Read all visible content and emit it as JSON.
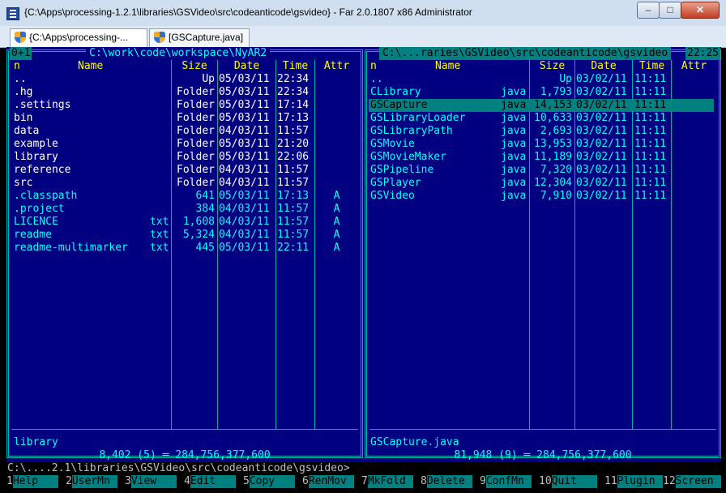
{
  "window": {
    "title": "{C:\\Apps\\processing-1.2.1\\libraries\\GSVideo\\src\\codeanticode\\gsvideo} - Far 2.0.1807 x86 Administrator",
    "minimize_label": "–",
    "maximize_label": "□",
    "close_label": "✕"
  },
  "tabs": [
    {
      "label": "{C:\\Apps\\processing-..."
    },
    {
      "label": "[GSCapture.java]"
    }
  ],
  "toolbar": {
    "console_number": "1"
  },
  "left_panel": {
    "marker": "0+1",
    "path": "C:\\work\\code\\workspace\\NyAR2",
    "headers": {
      "n": "n",
      "name": "Name",
      "size": "Size",
      "date": "Date",
      "time": "Time",
      "attr": "Attr"
    },
    "rows": [
      {
        "name": "..",
        "ext": "",
        "size": "Up",
        "date": "05/03/11",
        "time": "22:34",
        "attr": ""
      },
      {
        "name": ".hg",
        "ext": "",
        "size": "Folder",
        "date": "05/03/11",
        "time": "22:34",
        "attr": ""
      },
      {
        "name": ".settings",
        "ext": "",
        "size": "Folder",
        "date": "05/03/11",
        "time": "17:14",
        "attr": ""
      },
      {
        "name": "bin",
        "ext": "",
        "size": "Folder",
        "date": "05/03/11",
        "time": "17:13",
        "attr": ""
      },
      {
        "name": "data",
        "ext": "",
        "size": "Folder",
        "date": "04/03/11",
        "time": "11:57",
        "attr": ""
      },
      {
        "name": "example",
        "ext": "",
        "size": "Folder",
        "date": "05/03/11",
        "time": "21:20",
        "attr": ""
      },
      {
        "name": "library",
        "ext": "",
        "size": "Folder",
        "date": "05/03/11",
        "time": "22:06",
        "attr": ""
      },
      {
        "name": "reference",
        "ext": "",
        "size": "Folder",
        "date": "04/03/11",
        "time": "11:57",
        "attr": ""
      },
      {
        "name": "src",
        "ext": "",
        "size": "Folder",
        "date": "04/03/11",
        "time": "11:57",
        "attr": ""
      },
      {
        "name": ".classpath",
        "ext": "",
        "size": "641",
        "date": "05/03/11",
        "time": "17:13",
        "attr": "A"
      },
      {
        "name": ".project",
        "ext": "",
        "size": "384",
        "date": "04/03/11",
        "time": "11:57",
        "attr": "A"
      },
      {
        "name": "LICENCE",
        "ext": "txt",
        "size": "1,608",
        "date": "04/03/11",
        "time": "11:57",
        "attr": "A"
      },
      {
        "name": "readme",
        "ext": "txt",
        "size": "5,324",
        "date": "04/03/11",
        "time": "11:57",
        "attr": "A"
      },
      {
        "name": "readme-multimarker",
        "ext": "txt",
        "size": "445",
        "date": "05/03/11",
        "time": "22:11",
        "attr": "A"
      }
    ],
    "current_file": "library",
    "summary": "8,402 (5) ═ 284,756,377,600"
  },
  "right_panel": {
    "path": "C:\\...raries\\GSVideo\\src\\codeanticode\\gsvideo",
    "headers": {
      "n": "n",
      "name": "Name",
      "size": "Size",
      "date": "Date",
      "time": "Time",
      "attr": "Attr"
    },
    "rows": [
      {
        "name": "..",
        "ext": "",
        "size": "Up",
        "date": "03/02/11",
        "time": "11:11"
      },
      {
        "name": "CLibrary",
        "ext": "java",
        "size": "1,793",
        "date": "03/02/11",
        "time": "11:11"
      },
      {
        "name": "GSCapture",
        "ext": "java",
        "size": "14,153",
        "date": "03/02/11",
        "time": "11:11"
      },
      {
        "name": "GSLibraryLoader",
        "ext": "java",
        "size": "10,633",
        "date": "03/02/11",
        "time": "11:11"
      },
      {
        "name": "GSLibraryPath",
        "ext": "java",
        "size": "2,693",
        "date": "03/02/11",
        "time": "11:11"
      },
      {
        "name": "GSMovie",
        "ext": "java",
        "size": "13,953",
        "date": "03/02/11",
        "time": "11:11"
      },
      {
        "name": "GSMovieMaker",
        "ext": "java",
        "size": "11,189",
        "date": "03/02/11",
        "time": "11:11"
      },
      {
        "name": "GSPipeline",
        "ext": "java",
        "size": "7,320",
        "date": "03/02/11",
        "time": "11:11"
      },
      {
        "name": "GSPlayer",
        "ext": "java",
        "size": "12,304",
        "date": "03/02/11",
        "time": "11:11"
      },
      {
        "name": "GSVideo",
        "ext": "java",
        "size": "7,910",
        "date": "03/02/11",
        "time": "11:11"
      }
    ],
    "current_file": "GSCapture.java",
    "summary": "81,948 (9) ═ 284,756,377,600"
  },
  "clock": "22:25",
  "command_line": "C:\\....2.1\\libraries\\GSVideo\\src\\codeanticode\\gsvideo>",
  "keybar": [
    {
      "num": "1",
      "label": "Help"
    },
    {
      "num": "2",
      "label": "UserMn"
    },
    {
      "num": "3",
      "label": "View"
    },
    {
      "num": "4",
      "label": "Edit"
    },
    {
      "num": "5",
      "label": "Copy"
    },
    {
      "num": "6",
      "label": "RenMov"
    },
    {
      "num": "7",
      "label": "MkFold"
    },
    {
      "num": "8",
      "label": "Delete"
    },
    {
      "num": "9",
      "label": "ConfMn"
    },
    {
      "num": "10",
      "label": "Quit"
    },
    {
      "num": "11",
      "label": "Plugin"
    },
    {
      "num": "12",
      "label": "Screen"
    }
  ],
  "colors": {
    "panel_bg": "#000080",
    "frame": "#00b0b0",
    "file_text": "#00ffff",
    "folder_text": "#ffffff",
    "header_text": "#ffff00",
    "selection_bg": "#008080"
  }
}
